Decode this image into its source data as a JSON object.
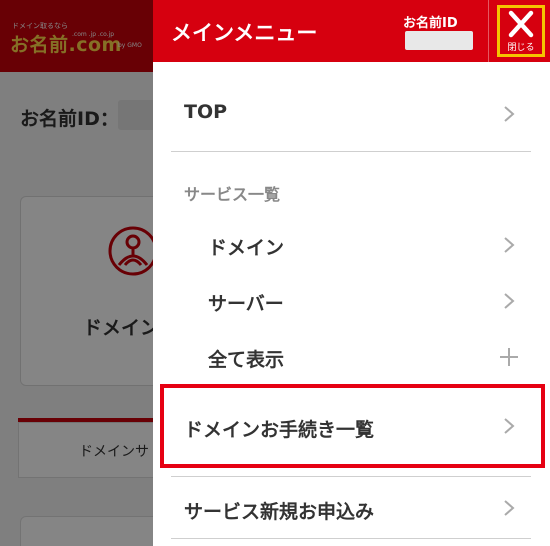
{
  "background_page": {
    "logo": {
      "tagline": "ドメイン取るなら",
      "domains": ".com .jp .co.jp",
      "name": "お名前.com",
      "by": "by GMO"
    },
    "id_label": "お名前ID：",
    "service_card_label": "ドメイン",
    "tab_label": "ドメインサ"
  },
  "drawer": {
    "title": "メインメニュー",
    "id_label": "お名前ID",
    "close_label": "閉じる",
    "items": {
      "top": "TOP",
      "section_title": "サービス一覧",
      "domain": "ドメイン",
      "server": "サーバー",
      "show_all": "全て表示",
      "domain_procedures": "ドメインお手続き一覧",
      "new_service": "サービス新規お申込み"
    }
  },
  "colors": {
    "brand_red": "#d6000f",
    "highlight_red": "#e60012",
    "close_highlight": "#f5c400"
  },
  "icons": {
    "chevron": "chevron-right-icon",
    "plus": "plus-icon",
    "close": "close-icon"
  }
}
